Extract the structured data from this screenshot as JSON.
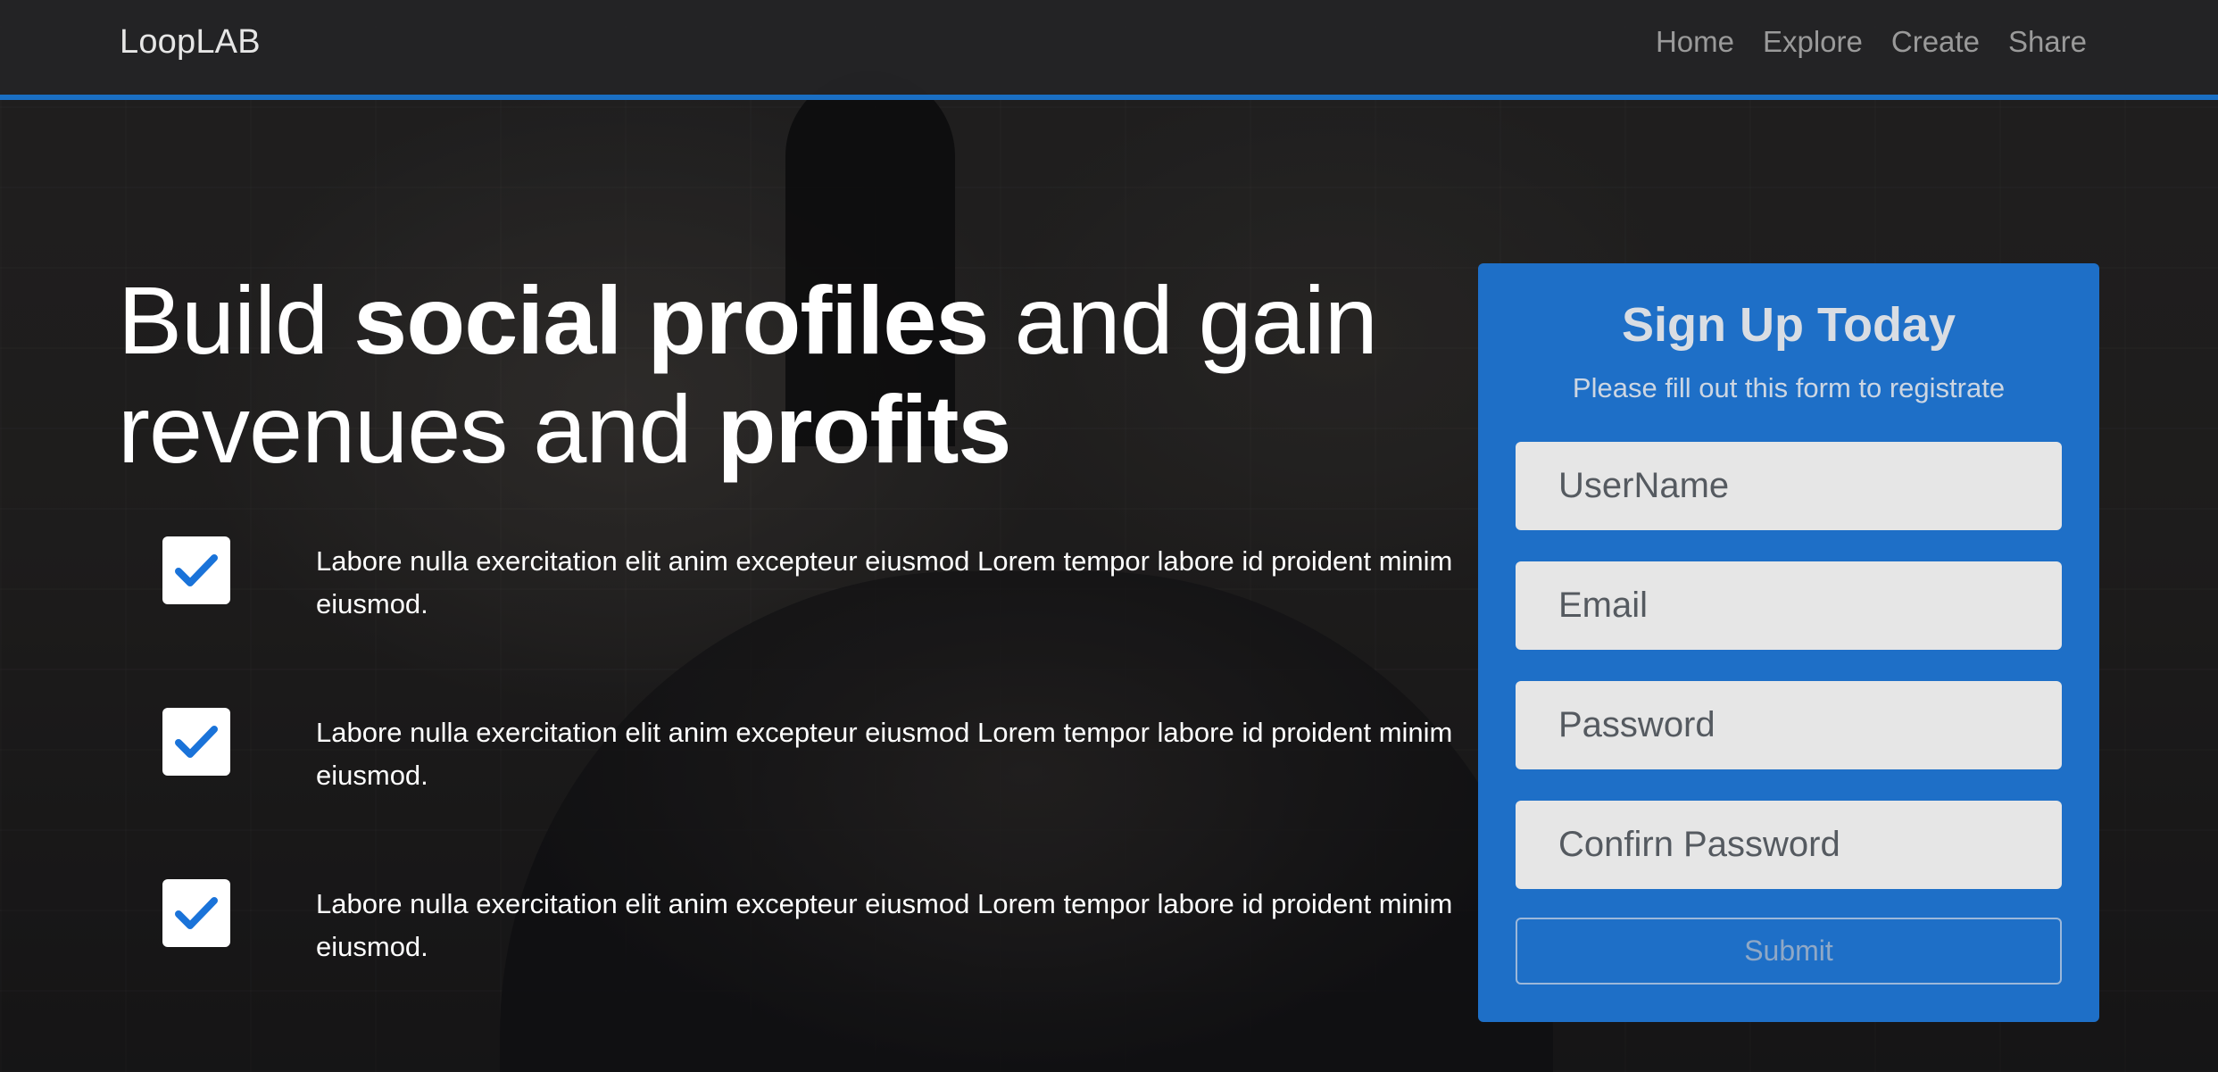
{
  "nav": {
    "brand": "LoopLAB",
    "links": [
      "Home",
      "Explore",
      "Create",
      "Share"
    ]
  },
  "hero": {
    "headline": {
      "part1": "Build ",
      "part2": "social profiles",
      "part3": " and gain revenues and ",
      "part4": "profits"
    },
    "features": [
      "Labore nulla exercitation elit anim excepteur eiusmod Lorem tempor labore id proident minim eiusmod.",
      "Labore nulla exercitation elit anim excepteur eiusmod Lorem tempor labore id proident minim eiusmod.",
      "Labore nulla exercitation elit anim excepteur eiusmod Lorem tempor labore id proident minim eiusmod."
    ]
  },
  "signup": {
    "title": "Sign Up Today",
    "subtitle": "Please fill out this form to registrate",
    "username_placeholder": "UserName",
    "email_placeholder": "Email",
    "password_placeholder": "Password",
    "confirm_placeholder": "Confirn Password",
    "submit_label": "Submit"
  },
  "colors": {
    "accent": "#1a6fc4",
    "card": "#1e6fc7",
    "check": "#1a73d9"
  },
  "icons": {
    "feature_check": "checkbox-checked-icon"
  }
}
